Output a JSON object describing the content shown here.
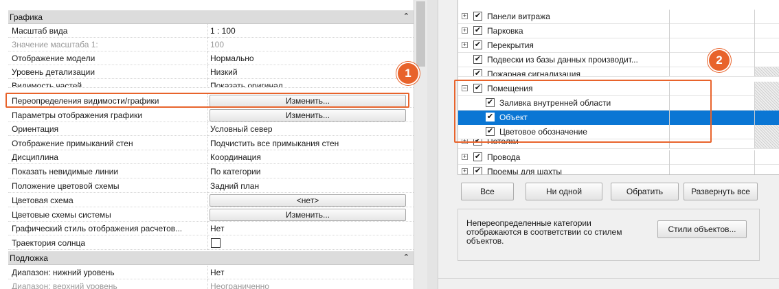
{
  "properties": {
    "group1": "Графика",
    "rows": [
      {
        "name": "Масштаб вида",
        "value": "1 : 100"
      },
      {
        "name": "Значение масштаба    1:",
        "value": "100"
      },
      {
        "name": "Отображение модели",
        "value": "Нормально"
      },
      {
        "name": "Уровень детализации",
        "value": "Низкий"
      },
      {
        "name": "Видимость частей",
        "value": "Показать оригинал"
      },
      {
        "name": "Переопределения видимости/графики",
        "value": "Изменить..."
      },
      {
        "name": "Параметры отображения графики",
        "value": "Изменить..."
      },
      {
        "name": "Ориентация",
        "value": "Условный север"
      },
      {
        "name": "Отображение примыканий стен",
        "value": "Подчистить все примыкания стен"
      },
      {
        "name": "Дисциплина",
        "value": "Координация"
      },
      {
        "name": "Показать невидимые линии",
        "value": "По категории"
      },
      {
        "name": "Положение цветовой схемы",
        "value": "Задний план"
      },
      {
        "name": "Цветовая схема",
        "value": "<нет>"
      },
      {
        "name": "Цветовые схемы системы",
        "value": "Изменить..."
      },
      {
        "name": "Графический стиль отображения расчетов...",
        "value": "Нет"
      },
      {
        "name": "Траектория солнца",
        "value": ""
      }
    ],
    "group2": "Подложка",
    "rows2": [
      {
        "name": "Диапазон: нижний уровень",
        "value": "Нет"
      },
      {
        "name": "Диапазон: верхний уровень",
        "value": "Неограниченно"
      }
    ]
  },
  "tree": {
    "items": [
      {
        "label": "Панели витража"
      },
      {
        "label": "Парковка"
      },
      {
        "label": "Перекрытия"
      },
      {
        "label": "Подвески из базы данных производит..."
      },
      {
        "label": "Пожарная сигнализация"
      },
      {
        "label": "Помещения"
      },
      {
        "label": "Заливка внутренней области"
      },
      {
        "label": "Объект"
      },
      {
        "label": "Цветовое обозначение"
      },
      {
        "label": "Потолки"
      },
      {
        "label": "Провода"
      },
      {
        "label": "Проемы для шахты"
      }
    ]
  },
  "buttons": {
    "all": "Все",
    "none": "Ни одной",
    "invert": "Обратить",
    "expand_all": "Развернуть все"
  },
  "info": {
    "text": "Непереопределенные категории отображаются в соответствии со стилем объектов.",
    "styles_button": "Стили объектов..."
  },
  "callouts": {
    "one": "1",
    "two": "2"
  },
  "colors": {
    "accent": "#e8632b",
    "selection": "#0a76d4"
  }
}
